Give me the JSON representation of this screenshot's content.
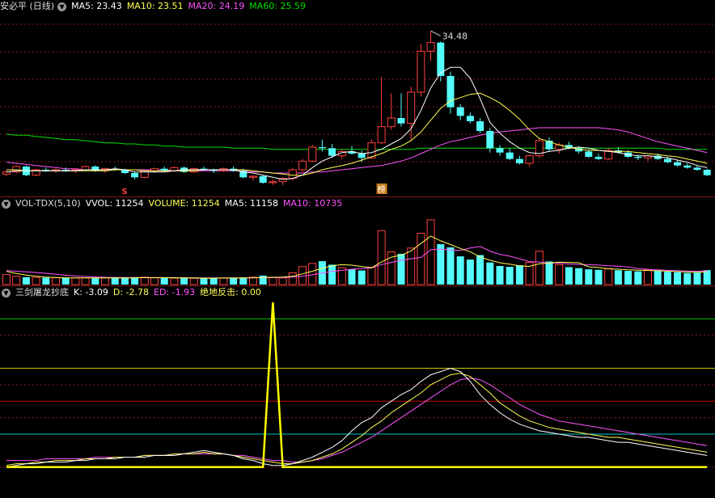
{
  "colors": {
    "up": "#ff4040",
    "down": "#54fcfc",
    "ma5": "#ffffff",
    "ma10": "#ffff54",
    "ma20": "#ff54ff",
    "ma60": "#00e000",
    "label": "#dddddd",
    "grid": "#8b1a1a"
  },
  "price_panel": {
    "title": "安必平 (日线)",
    "ma5_text": "MA5: 23.43",
    "ma10_text": "MA10: 23.51",
    "ma20_text": "MA20: 24.19",
    "ma60_text": "MA60: 25.59",
    "high_label": "34.48",
    "marker_s": "S",
    "marker_bang": "榜"
  },
  "volume_panel": {
    "title": "VOL-TDX(5,10)",
    "vvol_text": "VVOL: 11254",
    "volume_text": "VOLUME: 11254",
    "ma5_text": "MA5: 11158",
    "ma10_text": "MA10: 10735"
  },
  "indicator_panel": {
    "title": "三剑屠龙抄底",
    "k_text": "K: -3.09",
    "d_text": "D: -2.78",
    "ed_text": "ED: -1.93",
    "signal_text": "绝地反击: 0.00"
  },
  "chart_data": [
    {
      "type": "candlestick",
      "ylim": [
        19.5,
        36.0
      ],
      "candles": [
        [
          21.2,
          21.6,
          21.0,
          21.4
        ],
        [
          21.4,
          22.0,
          21.3,
          21.9
        ],
        [
          21.9,
          22.0,
          21.0,
          21.1
        ],
        [
          21.1,
          21.7,
          21.0,
          21.6
        ],
        [
          21.6,
          21.8,
          21.4,
          21.5
        ],
        [
          21.5,
          21.7,
          21.3,
          21.6
        ],
        [
          21.6,
          21.8,
          21.4,
          21.5
        ],
        [
          21.5,
          21.7,
          21.3,
          21.6
        ],
        [
          21.6,
          22.0,
          21.5,
          21.9
        ],
        [
          21.9,
          22.0,
          21.4,
          21.5
        ],
        [
          21.5,
          21.8,
          21.3,
          21.7
        ],
        [
          21.7,
          21.9,
          21.5,
          21.6
        ],
        [
          21.6,
          21.7,
          21.2,
          21.3
        ],
        [
          21.3,
          21.4,
          20.7,
          20.9
        ],
        [
          20.9,
          21.6,
          20.8,
          21.5
        ],
        [
          21.5,
          21.8,
          21.3,
          21.7
        ],
        [
          21.7,
          21.9,
          21.4,
          21.5
        ],
        [
          21.5,
          21.9,
          21.4,
          21.8
        ],
        [
          21.8,
          21.9,
          21.3,
          21.4
        ],
        [
          21.4,
          21.8,
          21.3,
          21.7
        ],
        [
          21.7,
          21.9,
          21.5,
          21.6
        ],
        [
          21.6,
          21.7,
          21.3,
          21.5
        ],
        [
          21.5,
          21.8,
          21.4,
          21.7
        ],
        [
          21.7,
          21.9,
          21.4,
          21.5
        ],
        [
          21.5,
          21.7,
          20.8,
          20.9
        ],
        [
          20.9,
          21.1,
          20.6,
          21.0
        ],
        [
          21.0,
          21.1,
          20.3,
          20.4
        ],
        [
          20.4,
          20.7,
          20.2,
          20.5
        ],
        [
          20.5,
          20.9,
          20.2,
          20.8
        ],
        [
          20.8,
          21.8,
          20.6,
          21.6
        ],
        [
          21.6,
          22.6,
          21.4,
          22.4
        ],
        [
          22.4,
          23.9,
          22.3,
          23.7
        ],
        [
          23.7,
          24.4,
          23.3,
          23.6
        ],
        [
          23.6,
          24.0,
          22.7,
          22.9
        ],
        [
          22.9,
          23.5,
          22.6,
          23.3
        ],
        [
          23.3,
          23.8,
          23.0,
          23.1
        ],
        [
          23.1,
          23.4,
          22.3,
          22.7
        ],
        [
          22.7,
          24.4,
          22.6,
          24.1
        ],
        [
          24.1,
          30.2,
          24.0,
          25.6
        ],
        [
          25.6,
          28.7,
          25.3,
          26.4
        ],
        [
          26.4,
          28.7,
          25.6,
          25.9
        ],
        [
          25.9,
          29.3,
          24.3,
          28.8
        ],
        [
          28.8,
          33.3,
          28.4,
          32.6
        ],
        [
          32.6,
          34.48,
          31.7,
          33.4
        ],
        [
          33.4,
          33.5,
          29.8,
          30.3
        ],
        [
          30.3,
          30.7,
          26.8,
          27.4
        ],
        [
          27.4,
          27.7,
          26.2,
          26.6
        ],
        [
          26.6,
          26.9,
          25.9,
          26.1
        ],
        [
          26.1,
          26.4,
          25.0,
          25.2
        ],
        [
          25.2,
          25.5,
          23.2,
          23.6
        ],
        [
          23.6,
          23.9,
          22.9,
          23.2
        ],
        [
          23.2,
          23.6,
          22.5,
          22.6
        ],
        [
          22.6,
          22.9,
          22.1,
          22.2
        ],
        [
          22.2,
          23.0,
          21.9,
          22.9
        ],
        [
          22.9,
          24.5,
          22.7,
          24.3
        ],
        [
          24.3,
          24.6,
          23.3,
          23.5
        ],
        [
          23.5,
          24.1,
          23.1,
          23.9
        ],
        [
          23.9,
          24.2,
          23.5,
          23.6
        ],
        [
          23.6,
          23.8,
          23.1,
          23.3
        ],
        [
          23.3,
          23.5,
          22.7,
          22.8
        ],
        [
          22.8,
          23.1,
          22.5,
          22.6
        ],
        [
          22.6,
          23.6,
          22.5,
          23.4
        ],
        [
          23.4,
          23.7,
          23.1,
          23.2
        ],
        [
          23.2,
          23.4,
          22.7,
          22.8
        ],
        [
          22.8,
          23.0,
          22.5,
          22.7
        ],
        [
          22.7,
          23.0,
          22.4,
          22.9
        ],
        [
          22.9,
          23.1,
          22.5,
          22.6
        ],
        [
          22.6,
          22.8,
          22.2,
          22.3
        ],
        [
          22.3,
          22.5,
          21.9,
          22.0
        ],
        [
          22.0,
          22.2,
          21.7,
          21.8
        ],
        [
          21.8,
          22.0,
          21.5,
          21.6
        ],
        [
          21.6,
          21.7,
          21.0,
          21.1
        ]
      ],
      "ma5": [
        21.4,
        21.5,
        21.5,
        21.5,
        21.5,
        21.5,
        21.5,
        21.5,
        21.6,
        21.6,
        21.6,
        21.7,
        21.6,
        21.4,
        21.4,
        21.4,
        21.4,
        21.5,
        21.6,
        21.6,
        21.6,
        21.6,
        21.6,
        21.6,
        21.4,
        21.3,
        21.1,
        20.9,
        20.7,
        20.8,
        21.1,
        21.8,
        22.4,
        22.8,
        23.2,
        23.3,
        23.1,
        23.2,
        23.5,
        24.0,
        24.5,
        25.4,
        27.1,
        29.2,
        30.6,
        31.1,
        31.1,
        30.1,
        28.2,
        26.0,
        25.0,
        24.2,
        23.6,
        23.2,
        23.1,
        23.3,
        23.4,
        23.6,
        23.7,
        23.6,
        23.4,
        23.3,
        23.2,
        23.0,
        22.9,
        22.9,
        22.8,
        22.7,
        22.5,
        22.3,
        22.0,
        21.8
      ],
      "ma10": [
        21.6,
        21.6,
        21.5,
        21.5,
        21.5,
        21.5,
        21.5,
        21.5,
        21.5,
        21.5,
        21.5,
        21.6,
        21.6,
        21.6,
        21.5,
        21.5,
        21.5,
        21.5,
        21.5,
        21.5,
        21.6,
        21.6,
        21.6,
        21.6,
        21.6,
        21.5,
        21.4,
        21.3,
        21.2,
        21.1,
        21.1,
        21.3,
        21.6,
        21.8,
        22.0,
        22.2,
        22.5,
        22.8,
        23.1,
        23.5,
        23.8,
        24.3,
        25.1,
        26.2,
        27.3,
        28.0,
        28.3,
        28.6,
        28.7,
        28.3,
        27.8,
        27.1,
        26.3,
        25.3,
        24.5,
        24.2,
        23.9,
        23.7,
        23.5,
        23.4,
        23.4,
        23.3,
        23.3,
        23.3,
        23.2,
        23.1,
        23.0,
        22.9,
        22.8,
        22.6,
        22.4,
        22.2
      ],
      "ma20": [
        22.3,
        22.2,
        22.1,
        22.0,
        21.9,
        21.8,
        21.7,
        21.7,
        21.6,
        21.6,
        21.6,
        21.6,
        21.6,
        21.6,
        21.6,
        21.6,
        21.6,
        21.5,
        21.5,
        21.5,
        21.5,
        21.5,
        21.5,
        21.5,
        21.5,
        21.4,
        21.4,
        21.3,
        21.3,
        21.3,
        21.3,
        21.4,
        21.4,
        21.5,
        21.6,
        21.7,
        21.8,
        21.9,
        22.0,
        22.2,
        22.4,
        22.7,
        23.1,
        23.5,
        23.9,
        24.2,
        24.4,
        24.6,
        24.8,
        25.0,
        25.1,
        25.2,
        25.3,
        25.4,
        25.5,
        25.5,
        25.5,
        25.5,
        25.5,
        25.5,
        25.5,
        25.4,
        25.3,
        25.1,
        24.8,
        24.5,
        24.2,
        24.0,
        23.8,
        23.6,
        23.4,
        23.2
      ],
      "ma60": [
        24.9,
        24.8,
        24.8,
        24.7,
        24.6,
        24.5,
        24.4,
        24.4,
        24.3,
        24.2,
        24.1,
        24.1,
        24.0,
        24.0,
        23.9,
        23.9,
        23.8,
        23.8,
        23.7,
        23.7,
        23.7,
        23.7,
        23.7,
        23.6,
        23.6,
        23.6,
        23.6,
        23.5,
        23.5,
        23.5,
        23.5,
        23.5,
        23.5,
        23.5,
        23.5,
        23.5,
        23.5,
        23.5,
        23.5,
        23.5,
        23.5,
        23.5,
        23.6,
        23.6,
        23.6,
        23.6,
        23.6,
        23.6,
        23.6,
        23.6,
        23.6,
        23.6,
        23.6,
        23.6,
        23.6,
        23.6,
        23.6,
        23.6,
        23.6,
        23.6,
        23.6,
        23.6,
        23.6,
        23.6,
        23.6,
        23.6,
        23.6,
        23.5,
        23.5,
        23.5,
        23.5,
        23.5
      ]
    },
    {
      "type": "bar",
      "ylim": [
        0,
        58000
      ],
      "volumes": [
        7800,
        6500,
        5800,
        5600,
        5400,
        5300,
        5200,
        5100,
        5200,
        5300,
        5200,
        5100,
        5000,
        5600,
        5800,
        5200,
        5100,
        5000,
        5000,
        4900,
        5200,
        5300,
        5100,
        5000,
        5500,
        5800,
        7000,
        5400,
        5200,
        9200,
        14000,
        16500,
        18200,
        15500,
        13200,
        12000,
        11000,
        13500,
        42000,
        25500,
        24000,
        28500,
        40000,
        50500,
        31500,
        29000,
        22000,
        19500,
        23000,
        17200,
        14500,
        13800,
        15000,
        17300,
        26000,
        18000,
        15500,
        13600,
        12800,
        11900,
        11500,
        12500,
        11200,
        10700,
        10300,
        11500,
        10800,
        10000,
        9600,
        9000,
        9300,
        11254
      ],
      "ma5": [
        10200,
        8700,
        7400,
        6400,
        5800,
        5500,
        5300,
        5200,
        5200,
        5200,
        5200,
        5200,
        5200,
        5300,
        5400,
        5400,
        5400,
        5300,
        5200,
        5100,
        5000,
        5000,
        5100,
        5100,
        5200,
        5300,
        5600,
        5700,
        5800,
        6500,
        8300,
        10400,
        12700,
        14700,
        15500,
        15100,
        14100,
        13100,
        17600,
        21400,
        22900,
        26300,
        32000,
        37900,
        34100,
        31200,
        28200,
        25600,
        21500,
        19000,
        17000,
        15900,
        14600,
        14200,
        16200,
        16700,
        17500,
        17300,
        17000,
        13900,
        13300,
        12300,
        12000,
        11500,
        11200,
        11000,
        10800,
        10400,
        10100,
        9800,
        9600,
        10000
      ],
      "ma10": [
        11000,
        10400,
        9900,
        9400,
        8800,
        8000,
        7300,
        6700,
        6300,
        5900,
        5700,
        5600,
        5500,
        5500,
        5400,
        5400,
        5400,
        5400,
        5300,
        5300,
        5200,
        5200,
        5200,
        5200,
        5200,
        5300,
        5400,
        5400,
        5500,
        5800,
        6400,
        7600,
        8900,
        10200,
        11100,
        12000,
        12500,
        13000,
        15600,
        17300,
        18900,
        20200,
        21100,
        27200,
        27600,
        26900,
        26700,
        28500,
        29700,
        26100,
        23600,
        22100,
        20100,
        17900,
        17600,
        16900,
        16700,
        16100,
        15700,
        15600,
        15200,
        14600,
        14400,
        13700,
        12400,
        11900,
        11500,
        11100,
        10800,
        10500,
        10400,
        10735
      ]
    },
    {
      "type": "line",
      "ylim": [
        -8,
        100
      ],
      "levels": [
        90,
        80,
        60,
        50,
        40,
        30,
        20,
        0
      ],
      "k": [
        0,
        1,
        2,
        2,
        3,
        3,
        3,
        4,
        4,
        5,
        5,
        5,
        6,
        6,
        6,
        7,
        7,
        7,
        8,
        9,
        10,
        9,
        8,
        7,
        5,
        4,
        2,
        1,
        1,
        2,
        4,
        6,
        9,
        12,
        16,
        22,
        27,
        30,
        36,
        40,
        44,
        47,
        52,
        56,
        58,
        60,
        58,
        52,
        44,
        38,
        33,
        29,
        26,
        24,
        22,
        21,
        20,
        19,
        18,
        18,
        17,
        16,
        15,
        15,
        14,
        13,
        12,
        11,
        10,
        9,
        8,
        7
      ],
      "d": [
        1,
        2,
        2,
        3,
        3,
        4,
        4,
        4,
        5,
        5,
        5,
        6,
        6,
        6,
        7,
        7,
        7,
        8,
        8,
        8,
        9,
        8,
        8,
        7,
        6,
        5,
        4,
        3,
        2,
        2,
        3,
        4,
        6,
        8,
        11,
        15,
        19,
        24,
        28,
        33,
        37,
        41,
        45,
        50,
        53,
        56,
        57,
        55,
        50,
        45,
        39,
        35,
        31,
        28,
        26,
        24,
        23,
        22,
        21,
        20,
        19,
        18,
        18,
        17,
        16,
        15,
        14,
        13,
        12,
        11,
        10,
        9
      ],
      "ed": [
        4,
        4,
        4,
        4,
        5,
        5,
        5,
        5,
        5,
        6,
        6,
        6,
        6,
        6,
        7,
        7,
        7,
        7,
        8,
        8,
        8,
        8,
        8,
        7,
        7,
        6,
        5,
        4,
        4,
        3,
        3,
        4,
        5,
        7,
        9,
        12,
        15,
        18,
        22,
        26,
        30,
        34,
        38,
        42,
        46,
        50,
        53,
        54,
        53,
        50,
        46,
        42,
        38,
        35,
        32,
        30,
        28,
        27,
        26,
        25,
        24,
        23,
        22,
        21,
        20,
        19,
        18,
        17,
        16,
        15,
        14,
        13
      ],
      "signal_spike_index": 27,
      "signal_spike_value": 100
    }
  ]
}
